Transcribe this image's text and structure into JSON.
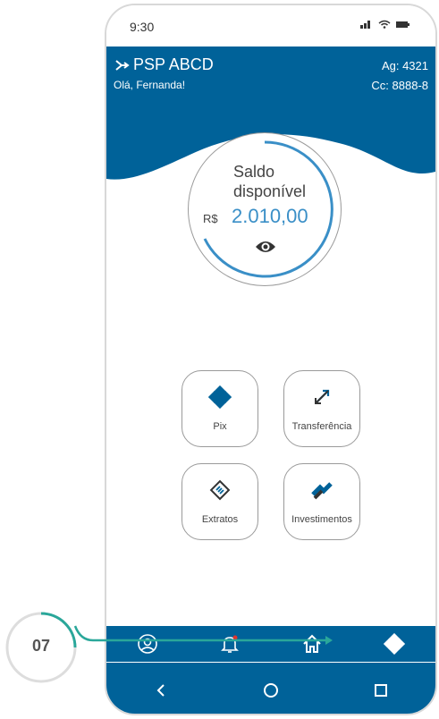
{
  "status_bar": {
    "time": "9:30"
  },
  "header": {
    "brand": "PSP ABCD",
    "greeting": "Olá, Fernanda!",
    "agency": "Ag: 4321",
    "account": "Cc: 8888-8"
  },
  "balance": {
    "label_line1": "Saldo",
    "label_line2": "disponível",
    "currency": "R$",
    "value": "2.010,00",
    "visibility_icon": "eye-icon"
  },
  "actions": [
    {
      "label": "Pix",
      "icon": "pix-icon"
    },
    {
      "label": "Transferência",
      "icon": "transfer-icon"
    },
    {
      "label": "Extratos",
      "icon": "statement-icon"
    },
    {
      "label": "Investimentos",
      "icon": "investments-icon"
    }
  ],
  "bottom_nav": [
    {
      "icon": "profile-icon"
    },
    {
      "icon": "bell-icon"
    },
    {
      "icon": "home-icon"
    },
    {
      "icon": "pix-icon"
    }
  ],
  "system_nav": [
    {
      "icon": "back-icon"
    },
    {
      "icon": "home-circle-icon"
    },
    {
      "icon": "recents-icon"
    }
  ],
  "annotation": {
    "step": "07"
  },
  "colors": {
    "brand_blue": "#006299",
    "accent_blue": "#3a8fc7",
    "teal": "#2aa79a",
    "notification_red": "#e0332c"
  }
}
